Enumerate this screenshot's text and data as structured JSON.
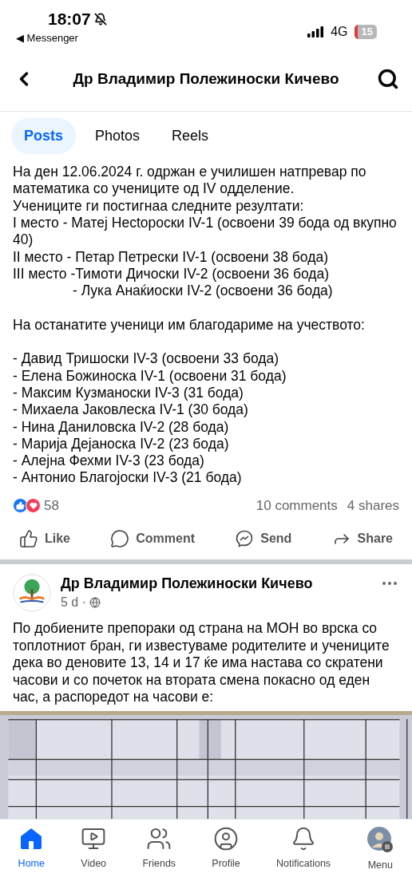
{
  "status_bar": {
    "time": "18:07",
    "back_app": "◀ Messenger",
    "network": "4G",
    "battery": "15"
  },
  "header": {
    "title": "Др Владимир Полежиноски Кичево"
  },
  "tabs": [
    {
      "label": "Posts",
      "selected": true
    },
    {
      "label": "Photos",
      "selected": false
    },
    {
      "label": "Reels",
      "selected": false
    }
  ],
  "post": {
    "paragraphs": [
      [
        {
          "kind": "line",
          "text": "На ден 12.06.2024 г.  одржан е училишен натпревар по математика со учениците од IV одделение."
        },
        {
          "kind": "line",
          "text": "Учениците ги постигнаа следните резултати:"
        },
        {
          "kind": "line",
          "text": "I место - Матеј Несtороски IV-1 (освоени 39 бода од вкупно 40)"
        },
        {
          "kind": "line",
          "text": "II место - Петар Петрески IV-1 (освоени 38 бода)"
        },
        {
          "kind": "line",
          "text": "III  место -Тимоти Дичоски IV-2 (освоени 36 бода)"
        },
        {
          "kind": "indent",
          "text": "- Лука Анаќиоски IV-2 (освоени 36 бода)"
        }
      ],
      [
        {
          "kind": "line",
          "text": "На останатите ученици им благодариме на учеството:"
        }
      ],
      [
        {
          "kind": "line",
          "text": "- Давид Тришоски IV-3 (освоени 33 бода)"
        },
        {
          "kind": "line",
          "text": "- Елена Божиноска IV-1 (освоени 31 бода)"
        },
        {
          "kind": "line",
          "text": "- Максим Кузманоски IV-3  (31 бода)"
        },
        {
          "kind": "line",
          "text": "- Михаела Јаковлеска IV-1 (30 бода)"
        },
        {
          "kind": "line",
          "text": "- Нина Даниловска IV-2 (28 бода)"
        },
        {
          "kind": "line",
          "text": "- Марија Дејаноска IV-2 (23 бода)"
        },
        {
          "kind": "line",
          "text": "- Алејна Фехми IV-3 (23 бода)"
        },
        {
          "kind": "line",
          "text": "- Антонио Благојоски IV-3  (21 бода)"
        }
      ]
    ],
    "reactions": "58",
    "comments": "10 comments",
    "shares": "4 shares",
    "actions": [
      {
        "kind": "like",
        "label": "Like"
      },
      {
        "kind": "comment",
        "label": "Comment"
      },
      {
        "kind": "send",
        "label": "Send"
      },
      {
        "kind": "share",
        "label": "Share"
      }
    ]
  },
  "post2": {
    "author": "Др Владимир Полежиноски Кичево",
    "time": "5 d ·",
    "text": "По добиените препораки од страна на МОН во врска со топлотниот бран,  ги известуваме родителите и учениците дека во деновите 13, 14 и 17 ќе има настава со скратени часови и со почеток на втората смена покасно од еден час, а распоредот на часови е:"
  },
  "nav": [
    {
      "kind": "home",
      "label": "Home",
      "selected": true
    },
    {
      "kind": "video",
      "label": "Video",
      "selected": false
    },
    {
      "kind": "friends",
      "label": "Friends",
      "selected": false
    },
    {
      "kind": "profile",
      "label": "Profile",
      "selected": false
    },
    {
      "kind": "notifications",
      "label": "Notifications",
      "selected": false
    },
    {
      "kind": "menu",
      "label": "Menu",
      "selected": false
    }
  ]
}
